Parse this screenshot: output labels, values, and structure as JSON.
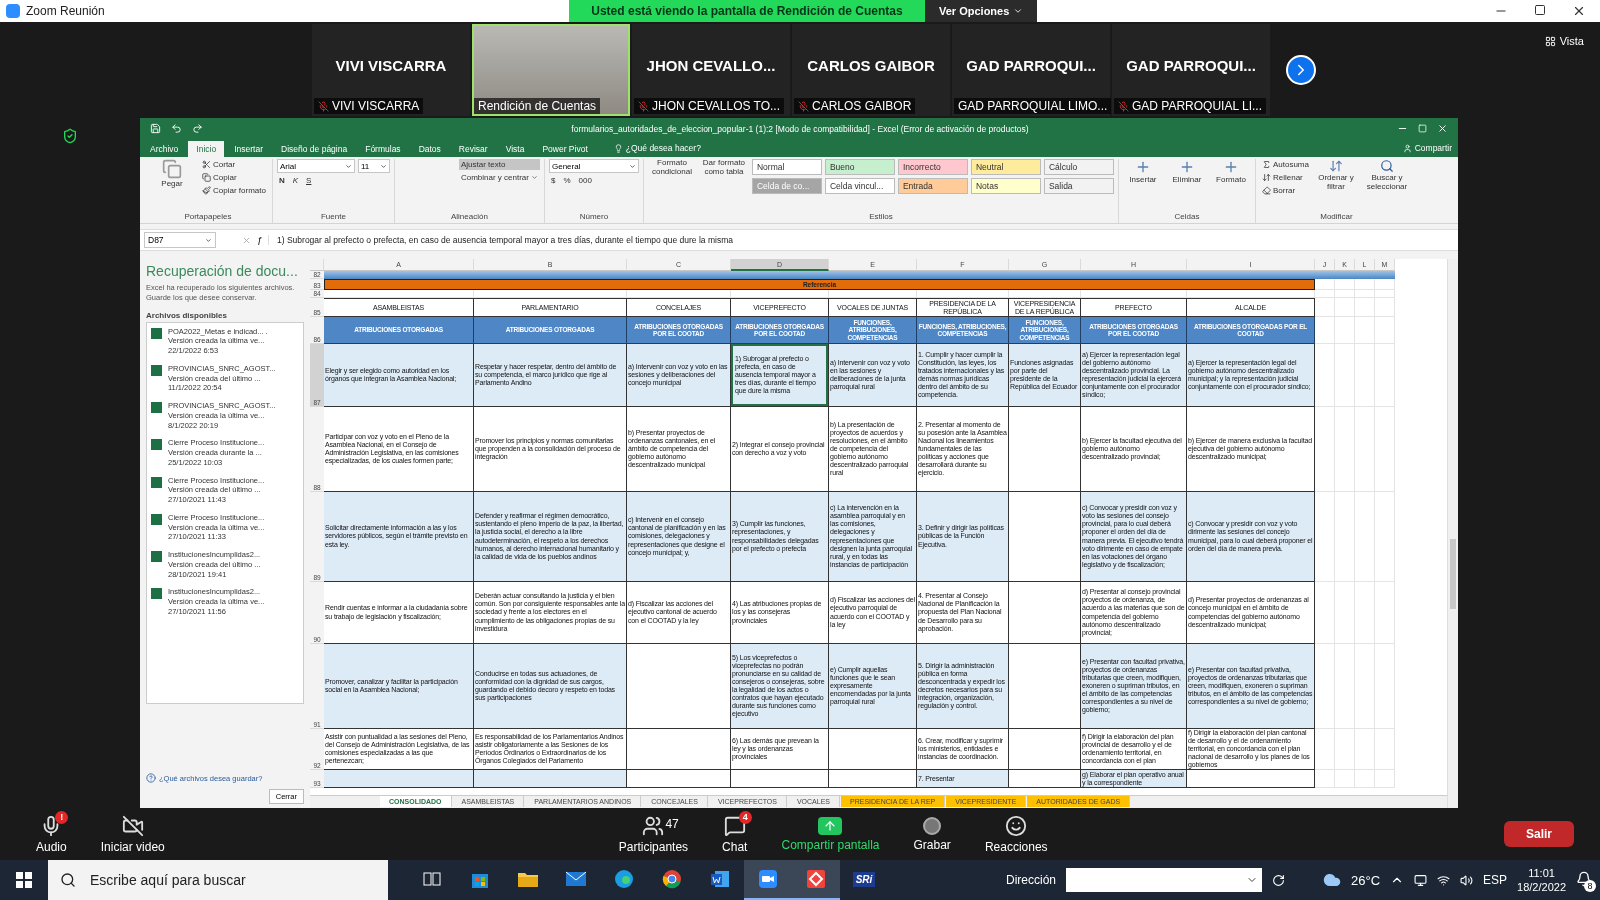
{
  "zoom_window": {
    "title": "Zoom Reunión",
    "share_banner": "Usted está viendo la pantalla de Rendición de Cuentas",
    "options_button": "Ver Opciones",
    "view_button": "Vista"
  },
  "participants": [
    {
      "kind": "name",
      "name": "VIVI VISCARRA",
      "label": "VIVI VISCARRA",
      "muted": true
    },
    {
      "kind": "video",
      "label": "Rendición de Cuentas",
      "muted": false
    },
    {
      "kind": "name",
      "name": "JHON  CEVALLO...",
      "label": "JHON CEVALLOS TO...",
      "muted": true
    },
    {
      "kind": "name",
      "name": "CARLOS GAIBOR",
      "label": "CARLOS GAIBOR",
      "muted": true
    },
    {
      "kind": "name",
      "name": "GAD  PARROQUI...",
      "label": "GAD PARROQUIAL LIMO...",
      "muted": false
    },
    {
      "kind": "name",
      "name": "GAD  PARROQUI...",
      "label": "GAD PARROQUIAL LI...",
      "muted": true
    }
  ],
  "excel": {
    "title": "formularios_autoridades_de_eleccion_popular-1 (1):2  [Modo de compatibilidad] - Excel (Error de activación de productos)",
    "tabs": [
      {
        "label": "Archivo",
        "selected": false
      },
      {
        "label": "Inicio",
        "selected": true
      },
      {
        "label": "Insertar",
        "selected": false
      },
      {
        "label": "Diseño de página",
        "selected": false
      },
      {
        "label": "Fórmulas",
        "selected": false
      },
      {
        "label": "Datos",
        "selected": false
      },
      {
        "label": "Revisar",
        "selected": false
      },
      {
        "label": "Vista",
        "selected": false
      },
      {
        "label": "Power Pivot",
        "selected": false
      }
    ],
    "tell_me": "¿Qué desea hacer?",
    "share": "Compartir",
    "ribbon": {
      "clipboard": {
        "paste": "Pegar",
        "items": [
          "Cortar",
          "Copiar",
          "Copiar formato"
        ],
        "group": "Portapapeles"
      },
      "font": {
        "name": "Arial",
        "size": "11",
        "bold": "N",
        "italic": "K",
        "underline": "S",
        "group": "Fuente"
      },
      "alignment": {
        "wrap": "Ajustar texto",
        "merge": "Combinar y centrar",
        "group": "Alineación"
      },
      "number": {
        "format": "General",
        "currency": "$",
        "percent": "%",
        "thousands": "000",
        "group": "Número"
      },
      "styles": {
        "conditional": "Formato condicional",
        "as_table": "Dar formato como tabla",
        "group": "Estilos",
        "cells": [
          {
            "label": "Normal",
            "color": "#ffffff"
          },
          {
            "label": "Bueno",
            "color": "#c6efce"
          },
          {
            "label": "Incorrecto",
            "color": "#ffc7ce"
          },
          {
            "label": "Neutral",
            "color": "#ffeb9c"
          },
          {
            "label": "Cálculo",
            "color": "#f2f2f2"
          },
          {
            "label": "Celda de co...",
            "color": "#a5a5a5"
          },
          {
            "label": "Celda vincul...",
            "color": "#ffffff"
          },
          {
            "label": "Entrada",
            "color": "#ffcc99"
          },
          {
            "label": "Notas",
            "color": "#ffffcc"
          },
          {
            "label": "Salida",
            "color": "#f2f2f2"
          }
        ]
      },
      "cells": {
        "items": [
          "Insertar",
          "Eliminar",
          "Formato"
        ],
        "group": "Celdas"
      },
      "editing": {
        "items": [
          "Autosuma",
          "Rellenar",
          "Borrar"
        ],
        "sort": "Ordenar y filtrar",
        "find": "Buscar y seleccionar",
        "group": "Modificar"
      }
    },
    "name_box": "D87",
    "fx": "ƒ",
    "formula": "1) Subrogar al prefecto o prefecta, en caso de ausencia temporal mayor a tres días, durante el tiempo que dure la misma",
    "recovery": {
      "title": "Recuperación de docu...",
      "description": "Excel ha recuperado los siguientes archivos. Guarde los que desee conservar.",
      "list_title": "Archivos disponibles",
      "files": [
        {
          "name": "POA2022_Metas e indicad... .",
          "note": "Versión creada la última ve...",
          "date": "22/1/2022 6:53"
        },
        {
          "name": "PROVINCIAS_SNRC_AGOST...",
          "note": "Versión creada del último ...",
          "date": "11/1/2022 20:54"
        },
        {
          "name": "PROVINCIAS_SNRC_AGOST...",
          "note": "Versión creada la última ve...",
          "date": "8/1/2022 20:19"
        },
        {
          "name": "Cierre Proceso Institucione...",
          "note": "Versión creada durante la ...",
          "date": "25/1/2022 10:03"
        },
        {
          "name": "Cierre Proceso Institucione...",
          "note": "Versión creada del último ...",
          "date": "27/10/2021 11:43"
        },
        {
          "name": "Cierre Proceso Institucione...",
          "note": "Versión creada la última ve...",
          "date": "27/10/2021 11:33"
        },
        {
          "name": "InstitucionesIncumplidas2...",
          "note": "Versión creada del último ...",
          "date": "28/10/2021 19:41"
        },
        {
          "name": "InstitucionesIncumplidas2...",
          "note": "Versión creada la última ve...",
          "date": "27/10/2021 11:56"
        }
      ],
      "help": "¿Qué archivos desea guardar?",
      "close": "Cerrar"
    },
    "sheet": {
      "columns": [
        {
          "label": "A",
          "selected": false
        },
        {
          "label": "B",
          "selected": false
        },
        {
          "label": "C",
          "selected": false
        },
        {
          "label": "D",
          "selected": true
        },
        {
          "label": "E",
          "selected": false
        },
        {
          "label": "F",
          "selected": false
        },
        {
          "label": "G",
          "selected": false
        },
        {
          "label": "H",
          "selected": false
        },
        {
          "label": "I",
          "selected": false
        },
        {
          "label": "J",
          "selected": false
        },
        {
          "label": "K",
          "selected": false
        },
        {
          "label": "L",
          "selected": false
        },
        {
          "label": "M",
          "selected": false
        }
      ],
      "rows": [
        {
          "number": "82",
          "kind": "band",
          "selected": false
        },
        {
          "number": "83",
          "kind": "title",
          "text": "Referencia",
          "selected": false
        },
        {
          "number": "84",
          "kind": "blank",
          "selected": false
        },
        {
          "number": "85",
          "kind": "header",
          "selected": false,
          "cells": [
            "ASAMBLEISTAS",
            "PARLAMENTARIO",
            "CONCELAJES",
            "VICEPREFECTO",
            "VOCALES DE JUNTAS",
            "PRESIDENCIA DE LA REPÚBLICA",
            "VICEPRESIDENCIA DE LA REPÚBLICA",
            "PREFECTO",
            "ALCALDE"
          ]
        },
        {
          "number": "86",
          "kind": "subheader",
          "selected": false,
          "cells": [
            "ATRIBUCIONES OTORGADAS",
            "ATRIBUCIONES OTORGADAS",
            "ATRIBUCIONES OTORGADAS POR EL COOTAD",
            "ATRIBUCIONES OTORGADAS POR EL COOTAD",
            "FUNCIONES, ATRIBUCIONES, COMPETENCIAS",
            "FUNCIONES, ATRIBUCIONES, COMPETENCIAS",
            "FUNCIONES, ATRIBUCIONES, COMPETENCIAS",
            "ATRIBUCIONES OTORGADAS POR EL COOTAD",
            "ATRIBUCIONES OTORGADAS POR EL COOTAD"
          ]
        },
        {
          "number": "87",
          "kind": "data",
          "shaded": true,
          "selected": true,
          "cells": [
            "Elegir y ser elegido como autoridad en los órganos que integran la Asamblea Nacional;",
            "Respetar y hacer respetar, dentro del ámbito de su competencia, el marco jurídico que rige al Parlamento Andino",
            "a) Intervenir con voz y voto en las sesiones y deliberaciones del concejo municipal",
            "1) Subrogar al prefecto o prefecta, en caso de ausencia temporal mayor a tres días, durante el tiempo que dure la misma",
            "a) Intervenir con voz y voto en las sesiones y deliberaciones de la junta parroquial rural",
            "1. Cumplir y hacer cumplir la Constitución, las leyes, los tratados internacionales y las demás normas jurídicas dentro del ámbito de su competencia.",
            "Funciones asignadas por parte del presidente de la República del Ecuador",
            "a) Ejercer la representación legal del gobierno autónomo descentralizado provincial. La representación judicial la ejercerá conjuntamente con el procurador síndico;",
            "a) Ejercer la representación legal del gobierno autónomo descentralizado municipal; y la representación judicial conjuntamente con el procurador síndico;"
          ]
        },
        {
          "number": "88",
          "kind": "data",
          "shaded": false,
          "selected": false,
          "cells": [
            "Participar con voz y voto en el Pleno de la Asamblea Nacional, en el Consejo de Administración Legislativa, en las comisiones especializadas, de los cuales formen parte;",
            "Promover los principios y normas comunitarias que propenden a la consolidación del proceso de integración",
            "b) Presentar proyectos de ordenanzas cantonales, en el ámbito de competencia del gobierno autónomo descentralizado municipal",
            "2) Integrar el consejo provincial con derecho a voz y voto",
            "b) La presentación de proyectos de acuerdos y resoluciones, en el ámbito de competencia del gobierno autónomo descentralizado parroquial rural",
            "2. Presentar al momento de su posesión ante la Asamblea Nacional los lineamientos fundamentales de las políticas y acciones que desarrollará durante su ejercicio.",
            null,
            "b) Ejercer la facultad ejecutiva del gobierno autónomo descentralizado provincial;",
            "b) Ejercer de manera exclusiva la facultad ejecutiva del gobierno autónomo descentralizado municipal;"
          ]
        },
        {
          "number": "89",
          "kind": "data",
          "shaded": true,
          "selected": false,
          "cells": [
            "Solicitar directamente información a las y los servidores públicos, según el trámite previsto en esta ley.",
            "Defender y reafirmar el régimen democrático, sustentando el pleno imperio de la paz, la libertad, la justicia social, el derecho a la libre autodeterminación, el respeto a los derechos humanos, al derecho internacional humanitario y la calidad de vida de los pueblos andinos",
            "c) Intervenir en el consejo cantonal de planificación y en las comisiones, delegaciones y representaciones que designe el concejo municipal; y,",
            "3) Cumplir las funciones, representaciones, y responsabilidades delegadas por el prefecto o prefecta",
            "c) La intervención en la asamblea parroquial y en las comisiones, delegaciones y representaciones que designen la junta parroquial rural, y en todas las instancias de participación",
            "3. Definir y dirigir las políticas públicas de la Función Ejecutiva.",
            null,
            "c) Convocar y presidir con voz y voto las sesiones del consejo provincial, para lo cual deberá proponer el orden del día de manera previa. El ejecutivo tendrá voto dirimente en caso de empate en las votaciones del órgano legislativo y de fiscalización;",
            "c) Convocar y presidir con voz y voto dirimente las sesiones del concejo municipal, para lo cual deberá proponer el orden del día de manera previa."
          ]
        },
        {
          "number": "90",
          "kind": "data",
          "shaded": false,
          "selected": false,
          "cells": [
            "Rendir cuentas e informar a la ciudadanía sobre su trabajo de legislación y fiscalización;",
            "Deberán actuar consultando la justicia y el bien común. Son por consiguiente responsables ante la sociedad y frente a los electores en el cumplimiento de las obligaciones propias de su investidura",
            "d) Fiscalizar las acciones del ejecutivo cantonal de acuerdo con el COOTAD y la ley",
            "4) Las atribuciones propias de los y las consejeras provinciales",
            "d) Fiscalizar las acciones del ejecutivo parroquial de acuerdo con el COOTAD y la ley",
            "4. Presentar al Consejo Nacional de Planificación la propuesta del Plan Nacional de Desarrollo para su aprobación.",
            null,
            "d) Presentar al consejo provincial proyectos de ordenanza, de acuerdo a las materias que son de competencia del gobierno autónomo descentralizado provincial;",
            "d) Presentar proyectos de ordenanzas al concejo municipal en el ámbito de competencias del gobierno autónomo descentralizado municipal;"
          ]
        },
        {
          "number": "91",
          "kind": "data",
          "shaded": true,
          "selected": false,
          "cells": [
            "Promover, canalizar y facilitar la participación social en la Asamblea Nacional;",
            "Conducirse en todas sus actuaciones, de conformidad con la dignidad de sus cargos, guardando el debido decoro y respeto en todas sus participaciones",
            null,
            "5) Los viceprefectos o viceprefectas no podrán pronunciarse en su calidad de consejeros o consejeras, sobre la legalidad de los actos o contratos que hayan ejecutado durante sus funciones como ejecutivo",
            "e) Cumplir aquellas funciones que le sean expresamente encomendadas por la junta parroquial rural",
            "5. Dirigir la administración pública en forma desconcentrada y expedir los decretos necesarios para su integración, organización, regulación y control.",
            null,
            "e) Presentar con facultad privativa, proyectos de ordenanzas tributarias que creen, modifiquen, exoneren o supriman tributos, en el ámbito de las competencias correspondientes a su nivel de gobierno;",
            "e) Presentar con facultad privativa, proyectos de ordenanzas tributarias que creen, modifiquen, exoneren o supriman tributos, en el ámbito de las competencias correspondientes a su nivel de gobierno;"
          ]
        },
        {
          "number": "92",
          "kind": "data",
          "shaded": false,
          "selected": false,
          "cells": [
            "Asistir con puntualidad a las sesiones del Pleno, del Consejo de Administración Legislativa, de las comisiones especializadas a las que pertenezcan;",
            "Es responsabilidad de los Parlamentarios Andinos asistir obligatoriamente a las Sesiones de los Períodos Ordinarios o Extraordinarios de los Órganos Colegiados del Parlamento",
            null,
            "6) Las demás que prevean la ley y las ordenanzas provinciales",
            null,
            "6. Crear, modificar y suprimir los ministerios, entidades e instancias de coordinación.",
            null,
            "f) Dirigir la elaboración del plan provincial de desarrollo y el de ordenamiento territorial, en concordancia con el plan",
            "f) Dirigir la elaboración del plan cantonal de desarrollo y el de ordenamiento territorial, en concordancia con el plan nacional de desarrollo y los planes de los gobiernos"
          ]
        },
        {
          "number": "93",
          "kind": "data",
          "shaded": true,
          "selected": false,
          "cells": [
            null,
            null,
            null,
            null,
            null,
            "7. Presentar",
            null,
            "g) Elaborar el plan operativo anual y la correspondiente",
            null
          ]
        }
      ]
    },
    "sheet_tabs": [
      {
        "label": "CONSOLIDADO",
        "selected": true,
        "color": "#ffffff"
      },
      {
        "label": "ASAMBLEISTAS",
        "selected": false,
        "color": "#f0f0f0"
      },
      {
        "label": "PARLAMENTARIOS ANDINOS",
        "selected": false,
        "color": "#f0f0f0"
      },
      {
        "label": "CONCEJALES",
        "selected": false,
        "color": "#f0f0f0"
      },
      {
        "label": "VICEPREFECTOS",
        "selected": false,
        "color": "#f0f0f0"
      },
      {
        "label": "VOCALES",
        "selected": false,
        "color": "#f0f0f0"
      },
      {
        "label": "PRESIDENCIA DE LA REP",
        "selected": false,
        "color": "#ffc000"
      },
      {
        "label": "VICEPRESIDENTE",
        "selected": false,
        "color": "#ffc000"
      },
      {
        "label": "AUTORIDADES DE GADS",
        "selected": false,
        "color": "#ffc000"
      }
    ]
  },
  "meeting_controls": [
    {
      "kind": "audio",
      "label": "Audio",
      "badge": "!"
    },
    {
      "kind": "video",
      "label": "Iniciar video"
    },
    {
      "kind": "participants",
      "label": "Participantes",
      "count": "47"
    },
    {
      "kind": "chat",
      "label": "Chat",
      "badge": "4"
    },
    {
      "kind": "share",
      "label": "Compartir pantalla"
    },
    {
      "kind": "record",
      "label": "Grabar"
    },
    {
      "kind": "reactions",
      "label": "Reacciones"
    }
  ],
  "leave_button": "Salir",
  "taskbar": {
    "search_placeholder": "Escribe aquí para buscar",
    "apps": [
      {
        "kind": "taskview",
        "active": false
      },
      {
        "kind": "store",
        "active": false
      },
      {
        "kind": "folder",
        "active": false
      },
      {
        "kind": "mail",
        "active": false
      },
      {
        "kind": "edge",
        "active": false
      },
      {
        "kind": "chrome",
        "active": false
      },
      {
        "kind": "word",
        "active": false
      },
      {
        "kind": "zoom",
        "active": true
      },
      {
        "kind": "remote",
        "active": true
      },
      {
        "kind": "sri",
        "active": false,
        "text": "SRi"
      }
    ],
    "address_label": "Dirección",
    "temperature": "26°C",
    "language": "ESP",
    "time": "11:01",
    "date": "18/2/2022",
    "notifications": "8"
  }
}
